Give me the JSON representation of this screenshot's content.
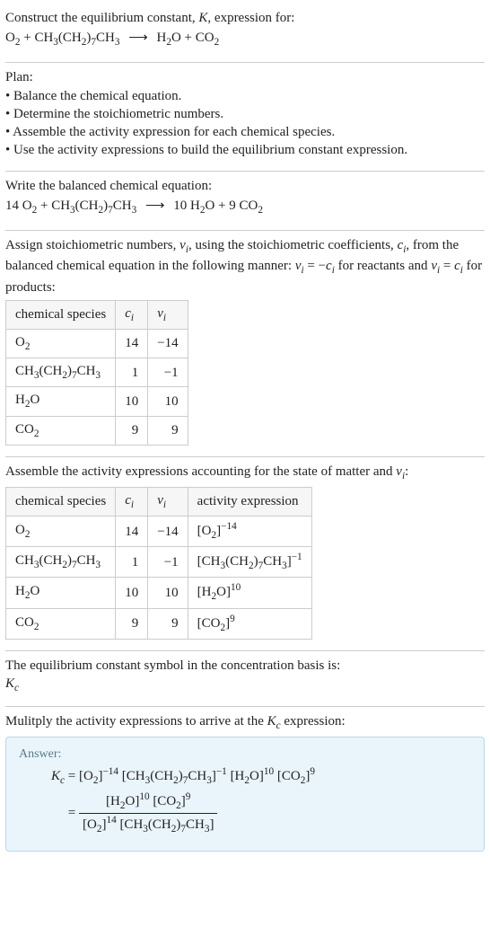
{
  "prompt": {
    "line1": "Construct the equilibrium constant, ",
    "K": "K",
    "line1b": ", expression for:",
    "reaction_lhs_a": "O",
    "reaction_lhs_a_sub": "2",
    "plus": " + ",
    "reaction_lhs_b": "CH",
    "b3": "3",
    "bparen": "(CH",
    "b2": "2",
    "bclose": ")",
    "b7": "7",
    "btail": "CH",
    "btail3": "3",
    "arrow": "⟶",
    "rhs_a": "H",
    "rhs_a2": "2",
    "rhs_aO": "O",
    "rhs_b": "CO",
    "rhs_b2": "2"
  },
  "plan": {
    "heading": "Plan:",
    "items": [
      "• Balance the chemical equation.",
      "• Determine the stoichiometric numbers.",
      "• Assemble the activity expression for each chemical species.",
      "• Use the activity expressions to build the equilibrium constant expression."
    ]
  },
  "balanced": {
    "intro": "Write the balanced chemical equation:",
    "c1": "14 ",
    "c2": "10 ",
    "c3": "9 "
  },
  "stoich_text": {
    "a": "Assign stoichiometric numbers, ",
    "nu": "ν",
    "i": "i",
    "b": ", using the stoichiometric coefficients, ",
    "c": "c",
    "d": ", from the balanced chemical equation in the following manner: ",
    "eq1": " = −",
    "e": " for reactants and ",
    "eq2": " = ",
    "f": " for products:"
  },
  "table1": {
    "headers": {
      "h1": "chemical species",
      "h2": "c",
      "h2i": "i",
      "h3": "ν",
      "h3i": "i"
    },
    "rows": [
      {
        "sp": "O2",
        "c": "14",
        "v": "−14"
      },
      {
        "sp": "CH3(CH2)7CH3",
        "c": "1",
        "v": "−1"
      },
      {
        "sp": "H2O",
        "c": "10",
        "v": "10"
      },
      {
        "sp": "CO2",
        "c": "9",
        "v": "9"
      }
    ]
  },
  "activity_intro": "Assemble the activity expressions accounting for the state of matter and ",
  "activity_intro2": ":",
  "table2": {
    "headers": {
      "h1": "chemical species",
      "h2": "c",
      "h2i": "i",
      "h3": "ν",
      "h3i": "i",
      "h4": "activity expression"
    },
    "rows": [
      {
        "sp": "O2",
        "c": "14",
        "v": "−14",
        "exp": "−14"
      },
      {
        "sp": "CH3(CH2)7CH3",
        "c": "1",
        "v": "−1",
        "exp": "−1"
      },
      {
        "sp": "H2O",
        "c": "10",
        "v": "10",
        "exp": "10"
      },
      {
        "sp": "CO2",
        "c": "9",
        "v": "9",
        "exp": "9"
      }
    ]
  },
  "basis": {
    "line1": "The equilibrium constant symbol in the concentration basis is:",
    "Kc": "K",
    "Kc_sub": "c"
  },
  "mult": "Mulitply the activity expressions to arrive at the ",
  "mult2": " expression:",
  "answer": {
    "label": "Answer:",
    "eq": " = ",
    "exp_m14": "−14",
    "exp_m1": "−1",
    "exp_10": "10",
    "exp_9": "9",
    "exp_14": "14"
  }
}
